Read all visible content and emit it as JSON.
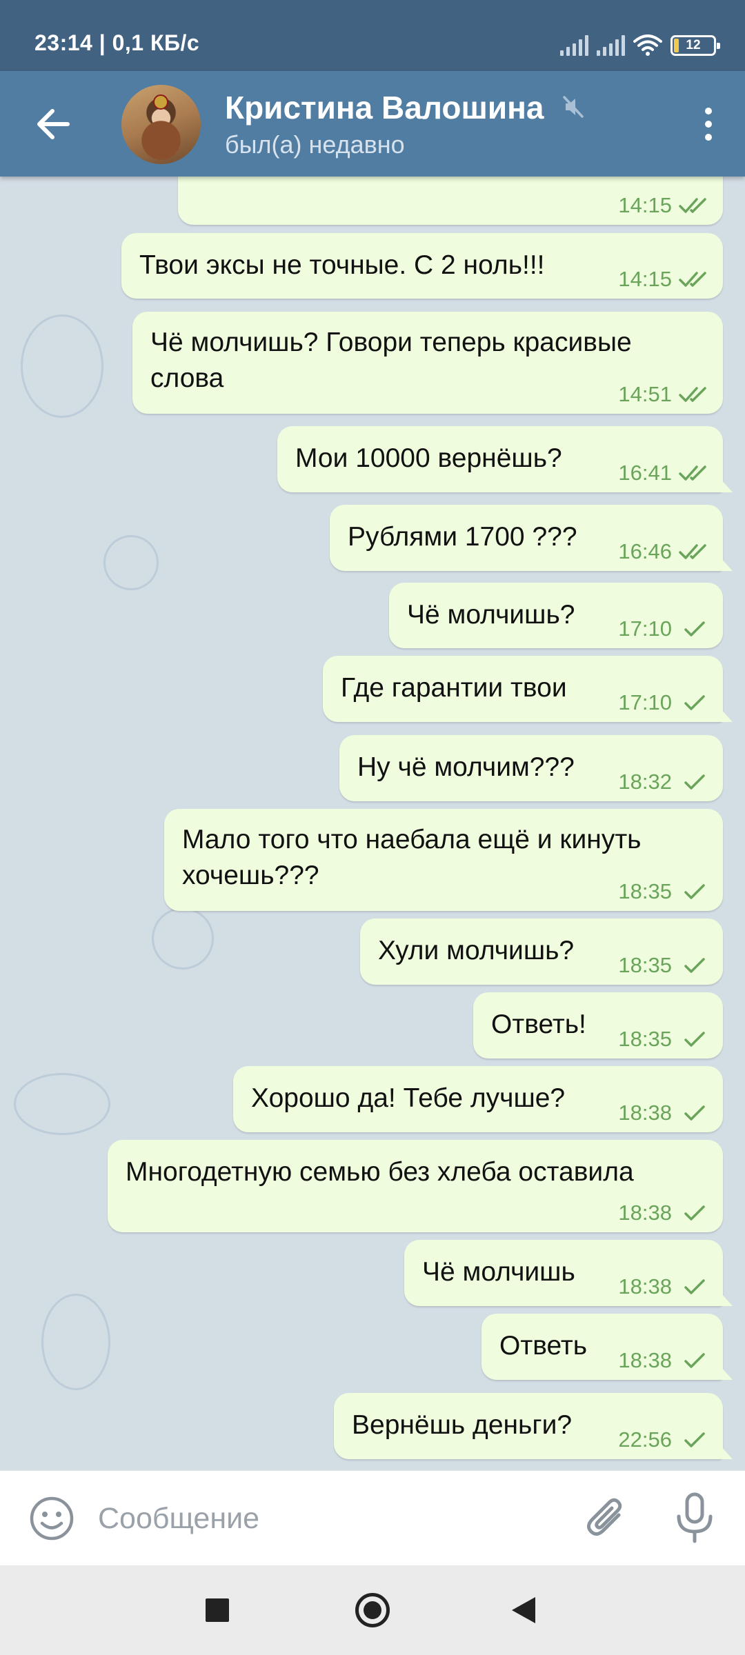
{
  "status_bar": {
    "time_speed": "23:14 | 0,1 КБ/с",
    "battery": "12"
  },
  "header": {
    "contact_name": "Кристина Валошина",
    "contact_status": "был(а) недавно",
    "muted": true
  },
  "messages": [
    {
      "text": "",
      "time": "14:15",
      "status": "read"
    },
    {
      "text": "Твои эксы не точные. С 2 ноль!!!",
      "time": "14:15",
      "status": "read"
    },
    {
      "text": "Чё молчишь? Говори теперь красивые",
      "text2": "слова",
      "time": "14:51",
      "status": "read"
    },
    {
      "text": "Мои 10000 вернёшь?",
      "time": "16:41",
      "status": "read"
    },
    {
      "text": "Рублями 1700 ???",
      "time": "16:46",
      "status": "read"
    },
    {
      "text": "Чё молчишь?",
      "time": "17:10",
      "status": "sent"
    },
    {
      "text": "Где гарантии твои",
      "time": "17:10",
      "status": "sent"
    },
    {
      "text": "Ну чё молчим???",
      "time": "18:32",
      "status": "sent"
    },
    {
      "text": "Мало того что наебала ещё и кинуть",
      "text2": "хочешь???",
      "time": "18:35",
      "status": "sent"
    },
    {
      "text": "Хули молчишь?",
      "time": "18:35",
      "status": "sent"
    },
    {
      "text": "Ответь!",
      "time": "18:35",
      "status": "sent"
    },
    {
      "text": "Хорошо да! Тебе лучше?",
      "time": "18:38",
      "status": "sent"
    },
    {
      "text": "Многодетную семью без хлеба оставила",
      "time": "18:38",
      "status": "sent"
    },
    {
      "text": "Чё молчишь",
      "time": "18:38",
      "status": "sent"
    },
    {
      "text": "Ответь",
      "time": "18:38",
      "status": "sent"
    },
    {
      "text": "Вернёшь деньги?",
      "time": "22:56",
      "status": "sent"
    }
  ],
  "input": {
    "placeholder": "Сообщение"
  },
  "icons": {
    "back": "arrow-left-icon",
    "mute": "muted-speaker-icon",
    "menu": "vertical-dots-icon",
    "emoji": "smiley-icon",
    "attach": "paperclip-icon",
    "mic": "microphone-icon",
    "read_tick": "double-check-icon",
    "sent_tick": "single-check-icon"
  },
  "colors": {
    "status_bar": "#426282",
    "header": "#517da2",
    "outgoing_bubble": "#effdde",
    "tick_time": "#6aa45a"
  }
}
